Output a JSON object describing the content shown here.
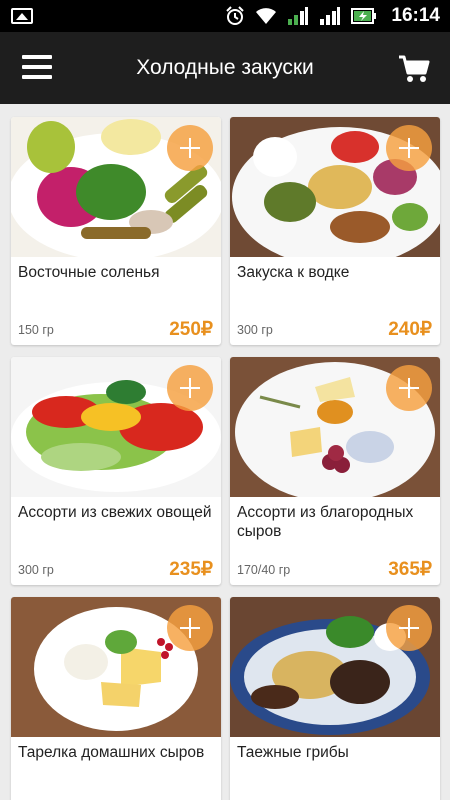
{
  "status_bar": {
    "time": "16:14",
    "icons": [
      "gallery-icon",
      "alarm-icon",
      "wifi-icon",
      "signal-1-icon",
      "signal-2-icon",
      "battery-charging-icon"
    ]
  },
  "app_bar": {
    "title": "Холодные закуски",
    "menu_icon": "hamburger-menu-icon",
    "cart_icon": "shopping-cart-icon"
  },
  "colors": {
    "accent": "#e8901e",
    "add_button": "#f5a040",
    "app_bar": "#1e1e1e",
    "background": "#ececec"
  },
  "products": [
    {
      "name": "Восточные соленья",
      "weight": "150 гр",
      "price": "250₽",
      "image_icon": "pickles-plate-image"
    },
    {
      "name": "Закуска к водке",
      "weight": "300 гр",
      "price": "240₽",
      "image_icon": "vodka-snack-plate-image"
    },
    {
      "name": "Ассорти из свежих овощей",
      "weight": "300 гр",
      "price": "235₽",
      "image_icon": "fresh-vegetables-plate-image"
    },
    {
      "name": "Ассорти из благородных сыров",
      "weight": "170/40 гр",
      "price": "365₽",
      "image_icon": "fine-cheese-plate-image"
    },
    {
      "name": "Тарелка домашних сыров",
      "weight": "",
      "price": "",
      "image_icon": "homemade-cheese-plate-image"
    },
    {
      "name": "Таежные грибы",
      "weight": "",
      "price": "",
      "image_icon": "taiga-mushrooms-plate-image"
    }
  ]
}
